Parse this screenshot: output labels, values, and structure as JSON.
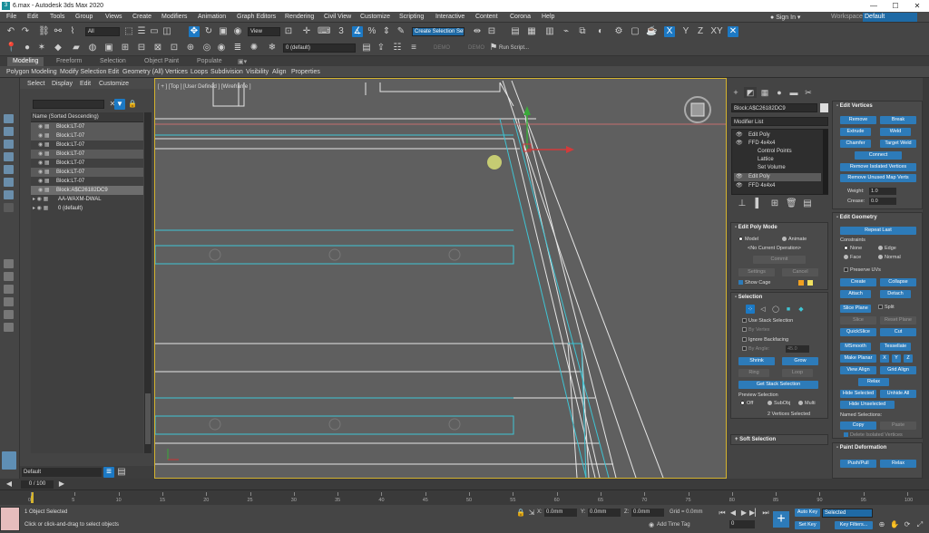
{
  "window": {
    "title": "6.max - Autodesk 3ds Max 2020",
    "min": "—",
    "max": "☐",
    "close": "✕"
  },
  "menubar": {
    "items": [
      "File",
      "Edit",
      "Tools",
      "Group",
      "Views",
      "Create",
      "Modifiers",
      "Animation",
      "Graph Editors",
      "Rendering",
      "Civil View",
      "Customize",
      "Scripting",
      "Interactive",
      "Content",
      "Corona",
      "Help"
    ],
    "sign_in": "Sign In",
    "workspaces_label": "Workspaces:",
    "workspaces_value": "Default"
  },
  "toolbar": {
    "filter_value": "All",
    "ref_coord": "View",
    "selection_set": "Create Selection Set",
    "layer_value": "0 (default)",
    "axes": [
      "X",
      "Y",
      "Z",
      "XY"
    ],
    "greyed": [
      "DEMO",
      "DEMO"
    ],
    "run_script": "Run Script..."
  },
  "ribbon": {
    "tabs": [
      "Modeling",
      "Freeform",
      "Selection",
      "Object Paint",
      "Populate"
    ],
    "row": [
      "Polygon Modeling",
      "Modify Selection",
      "Edit",
      "Geometry (All)",
      "Vertices",
      "Loops",
      "Subdivision",
      "Visibility",
      "Align",
      "Properties"
    ]
  },
  "scene_explorer": {
    "menu": [
      "Select",
      "Display",
      "Edit",
      "Customize"
    ],
    "header": "Name (Sorted Descending)",
    "rows": [
      {
        "label": "Block:LT-07",
        "indent": 1,
        "style": "alt"
      },
      {
        "label": "Block:LT-07",
        "indent": 1,
        "style": "alt"
      },
      {
        "label": "Block:LT-07",
        "indent": 1,
        "style": ""
      },
      {
        "label": "Block:LT-07",
        "indent": 1,
        "style": "alt"
      },
      {
        "label": "Block:LT-07",
        "indent": 1,
        "style": ""
      },
      {
        "label": "Block:LT-07",
        "indent": 1,
        "style": "alt"
      },
      {
        "label": "Block:LT-07",
        "indent": 1,
        "style": ""
      },
      {
        "label": "Block:A$C26182DC9",
        "indent": 1,
        "style": "sel"
      },
      {
        "label": "AA-WAXM-DWAL",
        "indent": 0,
        "style": ""
      },
      {
        "label": "0 (default)",
        "indent": 0,
        "style": ""
      }
    ],
    "layer_dropdown": "Default"
  },
  "viewport": {
    "label": "[ + ] [Top ] [User Defined ] [Wireframe ]"
  },
  "command_panel": {
    "object_name": "Block:A$C26182DC9",
    "modifier_list": "Modifier List",
    "stack": [
      "Edit Poly",
      "FFD 4x4x4",
      "Control Points",
      "Lattice",
      "Set Volume",
      "Edit Poly",
      "FFD 4x4x4"
    ],
    "edit_poly_mode": {
      "title": "Edit Poly Mode",
      "model": "Model",
      "animate": "Animate",
      "no_op": "<No Current Operation>",
      "commit": "Commit",
      "settings": "Settings",
      "cancel": "Cancel",
      "show_cage": "Show Cage"
    },
    "selection": {
      "title": "Selection",
      "use_stack": "Use Stack Selection",
      "by_vertex": "By Vertex",
      "ignore_backfacing": "Ignore Backfacing",
      "by_angle": "By Angle:",
      "angle_value": "45.0",
      "shrink": "Shrink",
      "grow": "Grow",
      "ring": "Ring",
      "loop": "Loop",
      "get_stack": "Get Stack Selection",
      "preview": "Preview Selection",
      "off": "Off",
      "subobj": "SubObj",
      "multi": "Multi",
      "status": "2 Vertices Selected"
    },
    "soft_selection": "Soft Selection",
    "edit_vertices": {
      "title": "Edit Vertices",
      "buttons": [
        [
          "Remove",
          "Break"
        ],
        [
          "Extrude",
          "Weld"
        ],
        [
          "Chamfer",
          "Target Weld"
        ]
      ],
      "connect": "Connect",
      "remove_isolated": "Remove Isolated Vertices",
      "remove_unused": "Remove Unused Map Verts",
      "weight_label": "Weight:",
      "weight_value": "1.0",
      "crease_label": "Crease:",
      "crease_value": "0.0"
    },
    "edit_geometry": {
      "title": "Edit Geometry",
      "repeat_last": "Repeat Last",
      "constraints": "Constraints",
      "none": "None",
      "edge": "Edge",
      "face": "Face",
      "normal": "Normal",
      "preserve_uvs": "Preserve UVs",
      "create": "Create",
      "collapse": "Collapse",
      "attach": "Attach",
      "detach": "Detach",
      "slice_plane": "Slice Plane",
      "split": "Split",
      "slice": "Slice",
      "reset_plane": "Reset Plane",
      "quickslice": "QuickSlice",
      "cut": "Cut",
      "msmooth": "MSmooth",
      "tessellate": "Tessellate",
      "make_planar": "Make Planar",
      "x": "X",
      "y": "Y",
      "z": "Z",
      "view_align": "View Align",
      "grid_align": "Grid Align",
      "relax": "Relax",
      "hide_selected": "Hide Selected",
      "unhide_all": "Unhide All",
      "hide_unselected": "Hide Unselected",
      "named_selections": "Named Selections:",
      "copy": "Copy",
      "paste": "Paste",
      "delete_isolated": "Delete Isolated Vertices"
    },
    "paint_deformation": {
      "title": "Paint Deformation",
      "push_pull": "Push/Pull",
      "relax": "Relax"
    }
  },
  "timeline": {
    "slider": "0 / 100",
    "ticks": [
      "0",
      "5",
      "10",
      "15",
      "20",
      "25",
      "30",
      "35",
      "40",
      "45",
      "50",
      "55",
      "60",
      "65",
      "70",
      "75",
      "80",
      "85",
      "90",
      "95",
      "100"
    ]
  },
  "status": {
    "line1": "1 Object Selected",
    "line2": "Click or click-and-drag to select objects",
    "x_label": "X:",
    "x_value": "0.0mm",
    "y_label": "Y:",
    "y_value": "0.0mm",
    "z_label": "Z:",
    "z_value": "0.0mm",
    "grid": "Grid = 0.0mm",
    "add_time_tag": "Add Time Tag",
    "auto_key": "Auto Key",
    "set_key": "Set Key",
    "selected": "Selected",
    "key_filters": "Key Filters...",
    "frame_value": "0"
  }
}
